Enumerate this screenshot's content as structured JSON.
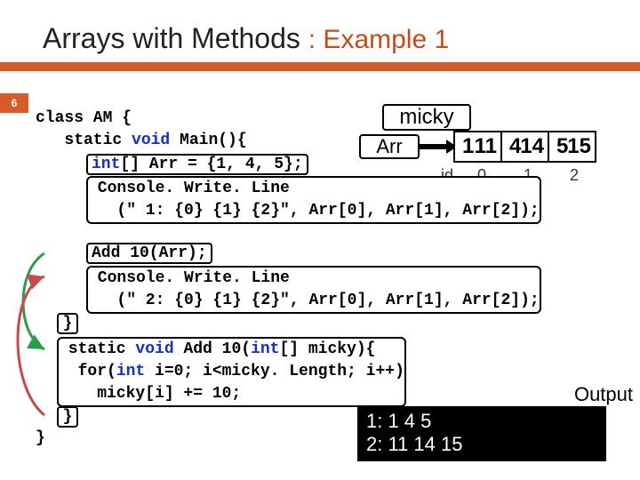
{
  "title_main": "Arrays with Methods ",
  "title_example": ": Example 1",
  "page_number": "6",
  "micky_label": "micky",
  "arr_label": "Arr",
  "arr_cells": [
    {
      "old": "1",
      "new": "11"
    },
    {
      "old": "4",
      "new": "14"
    },
    {
      "old": "5",
      "new": "15"
    }
  ],
  "id_label": "id",
  "arr_indices": [
    "0",
    "1",
    "2"
  ],
  "code": {
    "l1": "class AM {",
    "l2_pre": "   static ",
    "l2_void": "void",
    "l2_post": " Main(){",
    "intarr_int": "int",
    "intarr_rest": "[] Arr = {1, 4, 5};",
    "cw1_a": " Console. Write. Line",
    "cw1_b": "   (\" 1: {0} {1} {2}\", Arr[0], Arr[1], Arr[2]);",
    "add10call": "Add 10(Arr);",
    "cw2_a": " Console. Write. Line",
    "cw2_b": "   (\" 2: {0} {1} {2}\", Arr[0], Arr[1], Arr[2]);",
    "addsig_pre": " static ",
    "addsig_void": "void",
    "addsig_mid": " Add 10(",
    "addsig_int": "int",
    "addsig_post": "[] micky){",
    "for_pre": "  for(",
    "for_int": "int",
    "for_post": " i=0; i<micky. Length; i++)",
    "body": "    micky[i] += 10;",
    "brace": "}"
  },
  "output_label": "Output",
  "output": {
    "line1": "1: 1 4 5",
    "line2": "2: 11 14 15"
  }
}
